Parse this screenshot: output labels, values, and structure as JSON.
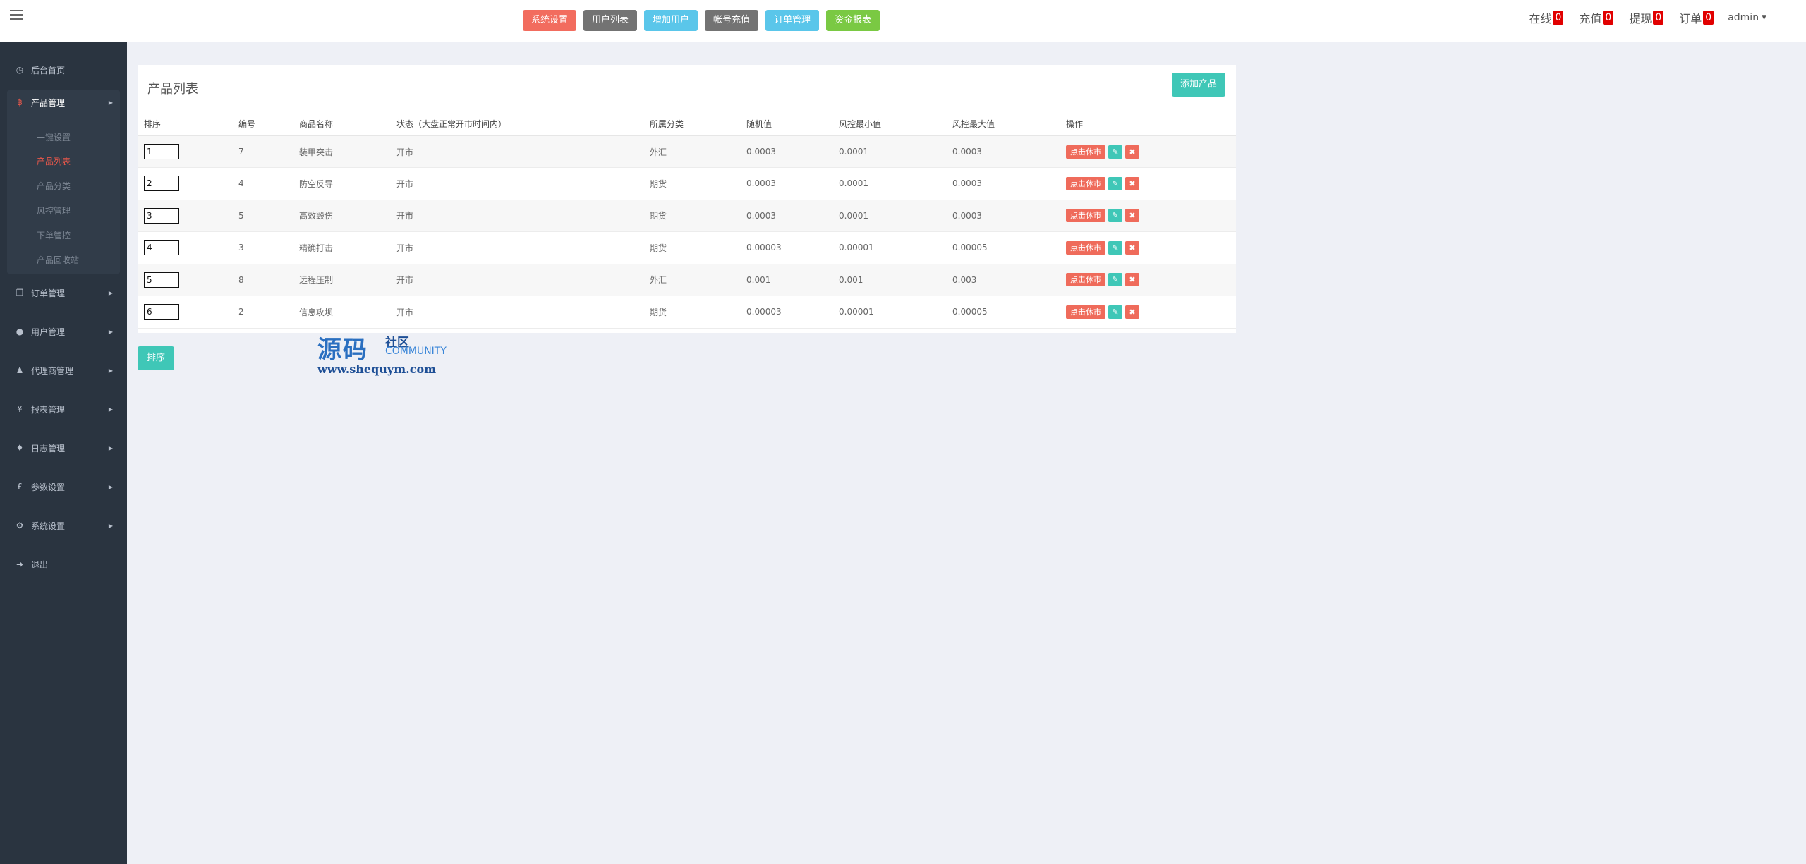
{
  "topbar": {
    "quick_buttons": [
      {
        "label": "系统设置",
        "color": "#f26c5e"
      },
      {
        "label": "用户列表",
        "color": "#737373"
      },
      {
        "label": "增加用户",
        "color": "#5ac6ea"
      },
      {
        "label": "帐号充值",
        "color": "#737373"
      },
      {
        "label": "订单管理",
        "color": "#5ac6ea"
      },
      {
        "label": "资金报表",
        "color": "#7ac943"
      }
    ],
    "stats": [
      {
        "label": "在线",
        "count": "0"
      },
      {
        "label": "充值",
        "count": "0"
      },
      {
        "label": "提现",
        "count": "0"
      },
      {
        "label": "订单",
        "count": "0"
      }
    ],
    "user": "admin"
  },
  "sidebar": {
    "items": [
      {
        "label": "后台首页",
        "icon": "dashboard-icon"
      },
      {
        "label": "产品管理",
        "icon": "bitcoin-icon"
      },
      {
        "label": "订单管理",
        "icon": "copy-icon"
      },
      {
        "label": "用户管理",
        "icon": "user-icon"
      },
      {
        "label": "代理商管理",
        "icon": "users-icon"
      },
      {
        "label": "报表管理",
        "icon": "yen-icon"
      },
      {
        "label": "日志管理",
        "icon": "ticket-icon"
      },
      {
        "label": "参数设置",
        "icon": "pound-icon"
      },
      {
        "label": "系统设置",
        "icon": "gears-icon"
      },
      {
        "label": "退出",
        "icon": "sign-out-icon"
      }
    ],
    "product_sub": [
      {
        "label": "一键设置"
      },
      {
        "label": "产品列表"
      },
      {
        "label": "产品分类"
      },
      {
        "label": "风控管理"
      },
      {
        "label": "下单管控"
      },
      {
        "label": "产品回收站"
      }
    ]
  },
  "panel": {
    "title": "产品列表",
    "add_label": "添加产品",
    "columns": [
      "排序",
      "编号",
      "商品名称",
      "状态（大盘正常开市时间内）",
      "所属分类",
      "随机值",
      "风控最小值",
      "风控最大值",
      "操作"
    ],
    "rows": [
      {
        "sort": "1",
        "id": "7",
        "name": "装甲突击",
        "status": "开市",
        "category": "外汇",
        "random": "0.0003",
        "min": "0.0001",
        "max": "0.0003"
      },
      {
        "sort": "2",
        "id": "4",
        "name": "防空反导",
        "status": "开市",
        "category": "期货",
        "random": "0.0003",
        "min": "0.0001",
        "max": "0.0003"
      },
      {
        "sort": "3",
        "id": "5",
        "name": "高效毁伤",
        "status": "开市",
        "category": "期货",
        "random": "0.0003",
        "min": "0.0001",
        "max": "0.0003"
      },
      {
        "sort": "4",
        "id": "3",
        "name": "精确打击",
        "status": "开市",
        "category": "期货",
        "random": "0.00003",
        "min": "0.00001",
        "max": "0.00005"
      },
      {
        "sort": "5",
        "id": "8",
        "name": "远程压制",
        "status": "开市",
        "category": "外汇",
        "random": "0.001",
        "min": "0.001",
        "max": "0.003"
      },
      {
        "sort": "6",
        "id": "2",
        "name": "信息攻坝",
        "status": "开市",
        "category": "期货",
        "random": "0.00003",
        "min": "0.00001",
        "max": "0.00005"
      }
    ],
    "row_action_label": "点击休市",
    "sort_button": "排序"
  },
  "watermark": {
    "big": "源码",
    "small_cn": "社区",
    "en": "COMMUNITY",
    "url": "www.shequym.com"
  }
}
